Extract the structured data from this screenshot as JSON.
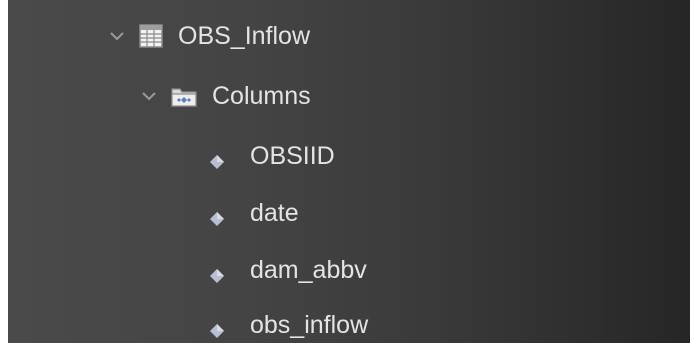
{
  "tree": {
    "table": {
      "name": "OBS_Inflow",
      "icon": "table-icon",
      "expanded": true
    },
    "columns_group": {
      "label": "Columns",
      "icon": "folder-icon",
      "expanded": true
    },
    "columns": [
      {
        "name": "OBSIID",
        "icon": "column-diamond-icon"
      },
      {
        "name": "date",
        "icon": "column-diamond-icon"
      },
      {
        "name": "dam_abbv",
        "icon": "column-diamond-icon"
      },
      {
        "name": "obs_inflow",
        "icon": "column-diamond-icon"
      }
    ]
  },
  "colors": {
    "panel_background": "#444444",
    "text": "#e4e4e4",
    "chevron": "#9a9a9a"
  }
}
